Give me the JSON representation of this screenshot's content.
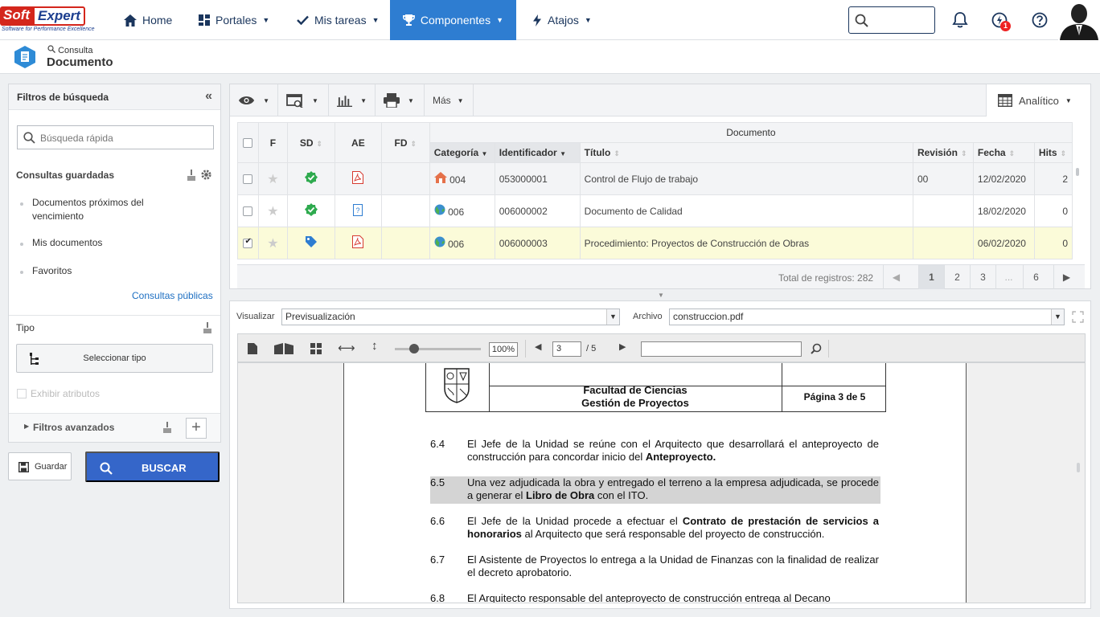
{
  "brand": {
    "name_part1": "Soft",
    "name_part2": "Expert",
    "tagline": "Software for Performance Excellence"
  },
  "nav": {
    "home": "Home",
    "portales": "Portales",
    "mis_tareas": "Mis tareas",
    "componentes": "Componentes",
    "atajos": "Atajos",
    "notification_badge": "1"
  },
  "header": {
    "breadcrumb": "Consulta",
    "title": "Documento"
  },
  "filters": {
    "title": "Filtros de búsqueda",
    "quick_search_placeholder": "Búsqueda rápida",
    "saved_queries_label": "Consultas guardadas",
    "saved_items": [
      "Documentos próximos del vencimiento",
      "Mis documentos",
      "Favoritos"
    ],
    "public_queries_link": "Consultas públicas",
    "tipo_label": "Tipo",
    "select_tipo_button": "Seleccionar tipo",
    "show_attributes": "Exhibir atributos",
    "advanced_filters": "Filtros avanzados",
    "save_button": "Guardar",
    "search_button": "BUSCAR"
  },
  "grid": {
    "toolbar": {
      "mas": "Más",
      "analitico": "Analítico"
    },
    "group_header": "Documento",
    "columns": {
      "f": "F",
      "sd": "SD",
      "ae": "AE",
      "fd": "FD",
      "categoria": "Categoría",
      "identificador": "Identificador",
      "titulo": "Título",
      "revision": "Revisión",
      "fecha": "Fecha",
      "hits": "Hits"
    },
    "rows": [
      {
        "categoria": "004",
        "identificador": "053000001",
        "titulo": "Control de Flujo de trabajo",
        "revision": "00",
        "fecha": "12/02/2020",
        "hits": "2",
        "checked": false
      },
      {
        "categoria": "006",
        "identificador": "006000002",
        "titulo": "Documento de Calidad",
        "revision": "",
        "fecha": "18/02/2020",
        "hits": "0",
        "checked": false
      },
      {
        "categoria": "006",
        "identificador": "006000003",
        "titulo": "Procedimiento: Proyectos de Construcción de Obras",
        "revision": "",
        "fecha": "06/02/2020",
        "hits": "0",
        "checked": true
      }
    ],
    "total_label": "Total de registros: 282",
    "pages": [
      "1",
      "2",
      "3",
      "...",
      "6"
    ]
  },
  "viewer": {
    "visualizar_label": "Visualizar",
    "visualizar_value": "Previsualización",
    "archivo_label": "Archivo",
    "archivo_value": "construccion.pdf",
    "zoom": "100%",
    "current_page": "3",
    "total_pages": "/ 5",
    "doc": {
      "faculty": "Facultad de Ciencias",
      "unit": "Gestión de Proyectos",
      "page_label": "Página 3 de 5",
      "paragraphs": [
        {
          "num": "6.4",
          "pre": "El Jefe de la Unidad se reúne con el Arquitecto que desarrollará el anteproyecto de construcción para concordar inicio del ",
          "bold": "Anteproyecto.",
          "post": ""
        },
        {
          "num": "6.5",
          "pre": "Una vez adjudicada la obra y entregado el terreno a la empresa adjudicada, se procede a generar el ",
          "bold": "Libro de Obra",
          "post": " con el ITO."
        },
        {
          "num": "6.6",
          "pre": "El Jefe de la Unidad procede a efectuar el ",
          "bold": "Contrato de prestación de servicios a honorarios",
          "post": " al Arquitecto que será responsable del proyecto de construcción."
        },
        {
          "num": "6.7",
          "pre": "El Asistente de Proyectos lo entrega a la Unidad de Finanzas con la finalidad de realizar el decreto aprobatorio.",
          "bold": "",
          "post": ""
        },
        {
          "num": "6.8",
          "pre": "El Arquitecto responsable del anteproyecto de construcción entrega al Decano",
          "bold": "",
          "post": ""
        }
      ]
    }
  }
}
